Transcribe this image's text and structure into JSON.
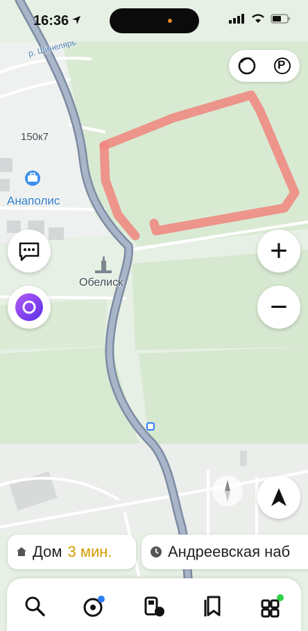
{
  "status_bar": {
    "time": "16:36"
  },
  "map": {
    "labels": {
      "street": "р. Шинелярь",
      "house": "150к7",
      "place": "Анаполис",
      "landmark": "Обелиск"
    },
    "highlight_color": "#f0857e"
  },
  "controls": {
    "zoom_in": "+",
    "zoom_out": "−",
    "layers_icon": "circle-icon",
    "parking_label": "P"
  },
  "chips": [
    {
      "label": "Дом",
      "eta": "3 мин.",
      "icon": "home-icon"
    },
    {
      "label": "Андреевская наб",
      "icon": "clock-icon"
    }
  ],
  "tabs": [
    {
      "icon": "search-icon"
    },
    {
      "icon": "navigator-icon"
    },
    {
      "icon": "fuel-icon"
    },
    {
      "icon": "bookmark-icon"
    },
    {
      "icon": "services-icon"
    }
  ],
  "colors": {
    "road": "#a9b5c9",
    "road_edge": "#7d8ba2",
    "alice": "#7d3cf2",
    "eta": "#d39a00",
    "dot_blue": "#2f7cf6",
    "dot_green": "#2fd24a"
  }
}
